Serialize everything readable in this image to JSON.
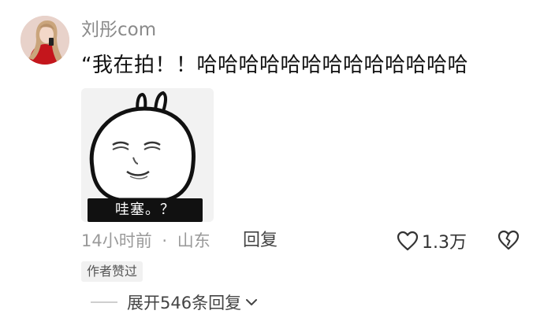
{
  "comment": {
    "username": "刘彤com",
    "text": "“我在拍！！哈哈哈哈哈哈哈哈哈哈哈哈哈",
    "sticker": {
      "caption": "哇塞。？",
      "icon": "bunny-meme-sticker"
    },
    "meta": {
      "time": "14小时前",
      "separator": "·",
      "location": "山东"
    },
    "reply_label": "回复",
    "likes": "1.3万",
    "author_badge": "作者赞过",
    "expand_replies_label": "展开546条回复"
  },
  "icons": {
    "avatar": "user-avatar",
    "like": "heart-outline-icon",
    "dislike": "broken-heart-icon",
    "expand": "chevron-down-icon"
  },
  "colors": {
    "username": "#8a8a8a",
    "text": "#111111",
    "meta": "#9a9a9a",
    "badge_bg": "#f1f1f1"
  }
}
